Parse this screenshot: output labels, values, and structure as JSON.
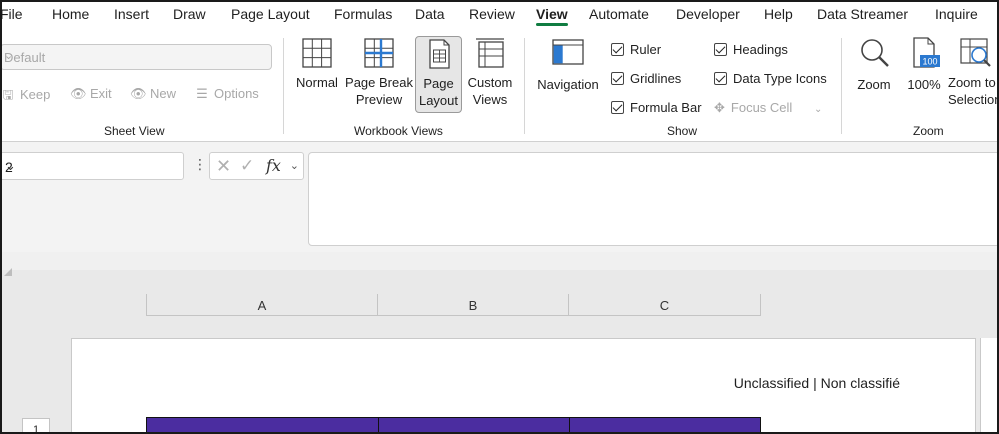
{
  "tabs": [
    "File",
    "Home",
    "Insert",
    "Draw",
    "Page Layout",
    "Formulas",
    "Data",
    "Review",
    "View",
    "Automate",
    "Developer",
    "Help",
    "Data Streamer",
    "Inquire"
  ],
  "active_tab": "View",
  "sheet_view": {
    "dropdown_value": "Default",
    "keep": "Keep",
    "exit": "Exit",
    "new": "New",
    "options": "Options",
    "label": "Sheet View"
  },
  "workbook_views": {
    "normal": "Normal",
    "page_break_line1": "Page Break",
    "page_break_line2": "Preview",
    "page_layout_line1": "Page",
    "page_layout_line2": "Layout",
    "custom_line1": "Custom",
    "custom_line2": "Views",
    "label": "Workbook Views"
  },
  "show": {
    "navigation": "Navigation",
    "ruler": "Ruler",
    "gridlines": "Gridlines",
    "formula_bar": "Formula Bar",
    "headings": "Headings",
    "data_type_icons": "Data Type Icons",
    "focus_cell": "Focus Cell",
    "label": "Show"
  },
  "zoom": {
    "zoom": "Zoom",
    "hundred": "100%",
    "hundred_icon_text": "100",
    "zoom_to_line1": "Zoom to",
    "zoom_to_line2": "Selection",
    "label": "Zoom"
  },
  "formula_bar": {
    "name_box": "2",
    "fx": "fx"
  },
  "sheet": {
    "columns": [
      "A",
      "B",
      "C"
    ],
    "header_text": "Unclassified | Non classifié",
    "row_number": "1"
  },
  "colors": {
    "accent": "#107c41",
    "table_header": "#4b2da0"
  }
}
